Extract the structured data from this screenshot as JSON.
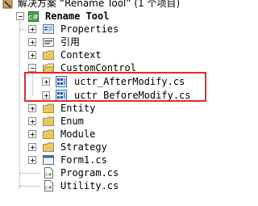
{
  "solution": {
    "label": "解决方案 “Rename Tool” (1 个项目)"
  },
  "project": {
    "label": "Rename Tool"
  },
  "items": [
    {
      "label": "Properties"
    },
    {
      "label": "引用"
    },
    {
      "label": "Context"
    },
    {
      "label": "CustomControl"
    },
    {
      "label": "uctr_AfterModify.cs"
    },
    {
      "label": "uctr_BeforeModify.cs"
    },
    {
      "label": "Entity"
    },
    {
      "label": "Enum"
    },
    {
      "label": "Module"
    },
    {
      "label": "Strategy"
    },
    {
      "label": "Form1.cs"
    },
    {
      "label": "Program.cs"
    },
    {
      "label": "Utility.cs"
    }
  ],
  "colors": {
    "highlight": "#d9302b",
    "folder": "#e8c766",
    "tree_line": "#a0a0a0"
  }
}
